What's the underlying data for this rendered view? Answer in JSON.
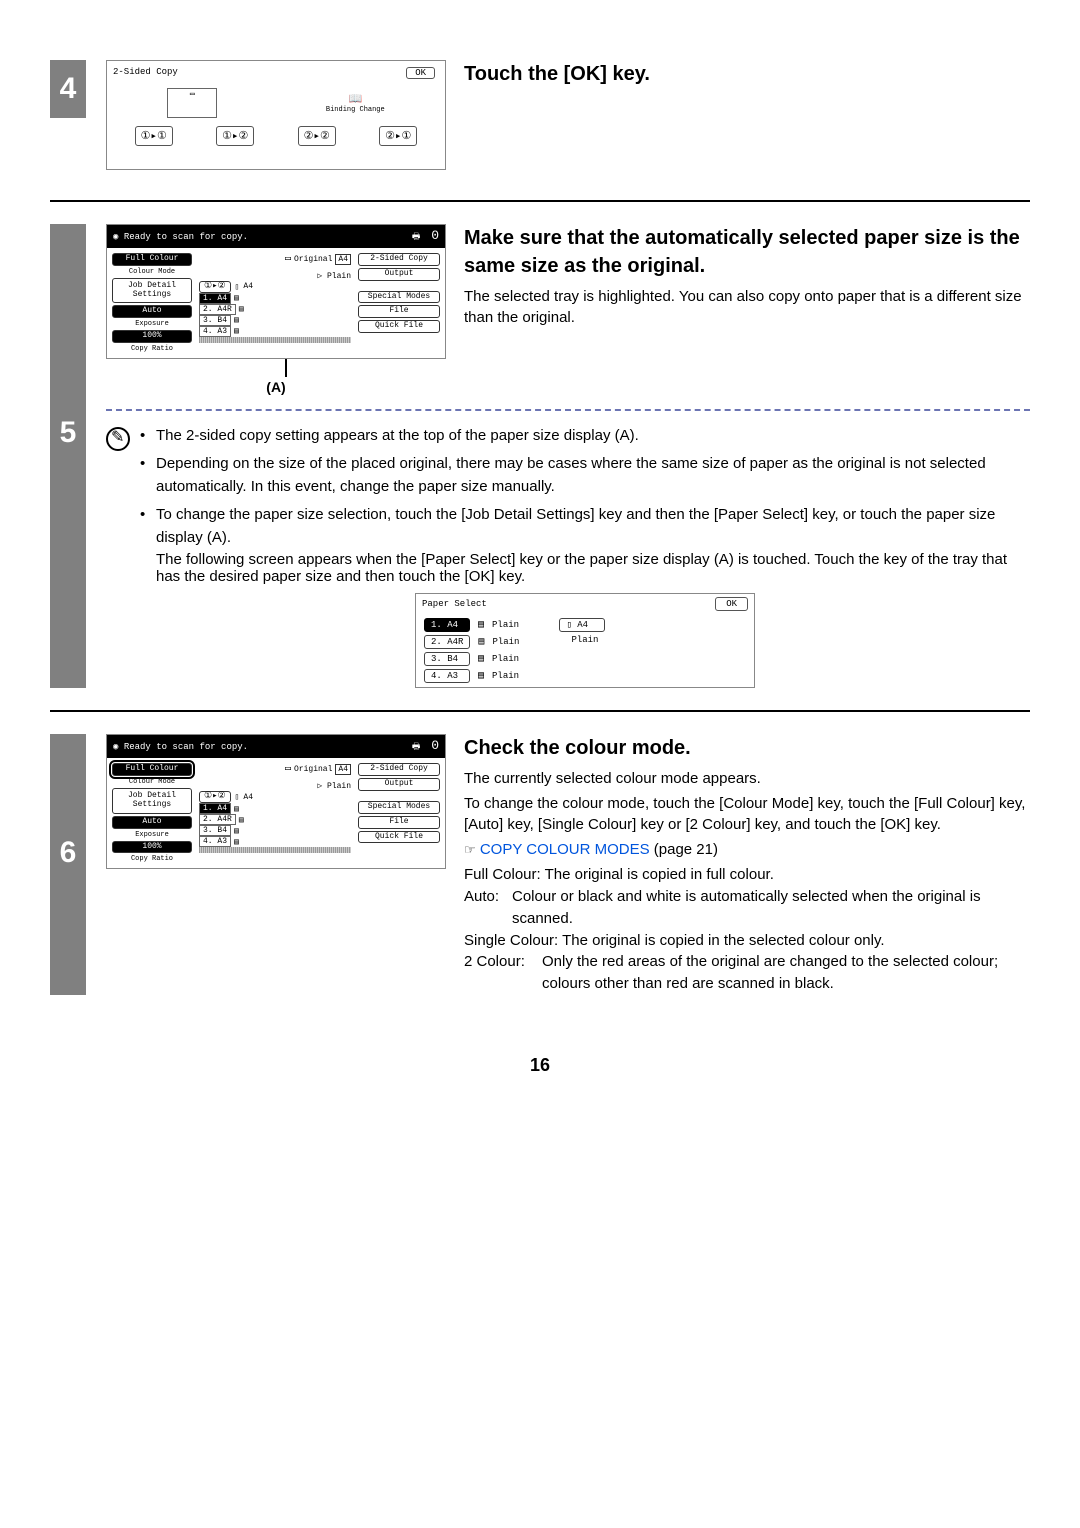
{
  "page_number": "16",
  "step4": {
    "number": "4",
    "heading": "Touch the [OK] key.",
    "lcd": {
      "title": "2-Sided Copy",
      "ok": "OK",
      "binding_label": "Binding Change",
      "buttons": [
        "①▸①",
        "①▸②",
        "②▸②",
        "②▸①"
      ]
    }
  },
  "step5": {
    "number": "5",
    "heading": "Make sure that the automatically selected paper size is the same size as the original.",
    "desc": "The selected tray is highlighted. You can also copy onto paper that is a different size than the original.",
    "label_A": "(A)",
    "bullets": {
      "b1": "The 2-sided copy setting appears at the top of the paper size display (A).",
      "b2": "Depending on the size of the placed original, there may be cases where the same size of paper as the original is not selected automatically. In this event, change the paper size manually.",
      "b3": "To change the paper size selection, touch the [Job Detail Settings] key and then the [Paper Select] key, or touch the paper size display (A).",
      "b3a": "The following screen appears when the [Paper Select] key or the paper size display (A) is touched. Touch the key of the tray that has the desired paper size and then touch the [OK] key."
    },
    "lcd": {
      "status": "Ready to scan for copy.",
      "counter": "0",
      "left": {
        "full_colour": "Full Colour",
        "colour_mode": "Colour Mode",
        "job_detail": "Job Detail Settings",
        "auto": "Auto",
        "exposure": "Exposure",
        "ratio_val": "100%",
        "copy_ratio": "Copy Ratio"
      },
      "mid": {
        "original": "Original",
        "orig_size": "A4",
        "plain": "Plain",
        "size2": "A4",
        "trays": [
          {
            "n": "1.",
            "s": "A4"
          },
          {
            "n": "2.",
            "s": "A4R"
          },
          {
            "n": "3.",
            "s": "B4"
          },
          {
            "n": "4.",
            "s": "A3"
          }
        ]
      },
      "right": {
        "two_sided": "2-Sided Copy",
        "output": "Output",
        "special": "Special Modes",
        "file": "File",
        "quick": "Quick File"
      }
    },
    "paper_select": {
      "title": "Paper Select",
      "ok": "OK",
      "rows": [
        {
          "key": "1. A4",
          "type": "Plain"
        },
        {
          "key": "2. A4R",
          "type": "Plain"
        },
        {
          "key": "3. B4",
          "type": "Plain"
        },
        {
          "key": "4. A3",
          "type": "Plain"
        }
      ],
      "side_size": "A4",
      "side_type": "Plain"
    }
  },
  "step6": {
    "number": "6",
    "heading": "Check the colour mode.",
    "p1": "The currently selected colour mode appears.",
    "p2": "To change the colour mode, touch the [Colour Mode] key, touch the [Full Colour] key, [Auto] key, [Single Colour] key or [2 Colour] key, and touch the [OK] key.",
    "link": "COPY COLOUR MODES",
    "link_page": " (page 21)",
    "d1": "Full Colour: The original is copied in full colour.",
    "d2a": "Auto:",
    "d2b": "Colour or black and white is automatically selected when the original is scanned.",
    "d3": "Single Colour: The original is copied in the selected colour only.",
    "d4a": "2 Colour:",
    "d4b": "Only the red areas of the original are changed to the selected colour; colours other than red are scanned in black.",
    "lcd": {
      "status": "Ready to scan for copy.",
      "counter": "0"
    }
  }
}
